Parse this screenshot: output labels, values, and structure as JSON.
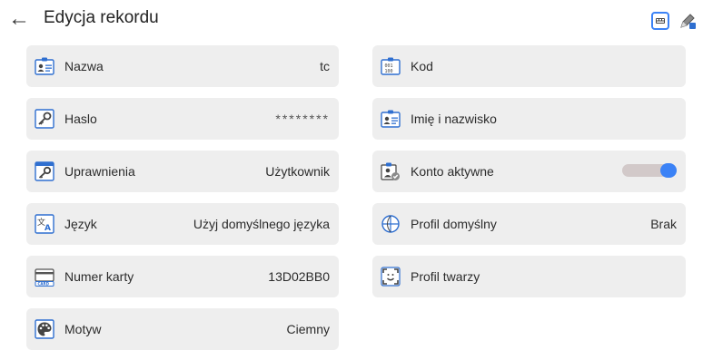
{
  "header": {
    "title": "Edycja rekordu",
    "back_icon": "arrow-left-icon",
    "right_icons": [
      "keyboard-icon",
      "edit-icon"
    ]
  },
  "fields_left": [
    {
      "label": "Nazwa",
      "value": "tc",
      "icon": "user-card-icon"
    },
    {
      "label": "Haslo",
      "value": "********",
      "icon": "key-icon"
    },
    {
      "label": "Uprawnienia",
      "value": "Użytkownik",
      "icon": "permissions-key-icon"
    },
    {
      "label": "Język",
      "value": "Użyj domyślnego języka",
      "icon": "translate-icon"
    },
    {
      "label": "Numer karty",
      "value": "13D02BB0",
      "icon": "card-icon"
    },
    {
      "label": "Motyw",
      "value": "Ciemny",
      "icon": "palette-icon"
    }
  ],
  "fields_right": [
    {
      "label": "Kod",
      "value": "",
      "icon": "code-card-icon"
    },
    {
      "label": "Imię i nazwisko",
      "value": "",
      "icon": "user-card-icon"
    },
    {
      "label": "Konto aktywne",
      "toggle_on": true,
      "icon": "user-check-icon"
    },
    {
      "label": "Profil domyślny",
      "value": "Brak",
      "icon": "globe-profile-icon"
    },
    {
      "label": "Profil twarzy",
      "value": "",
      "icon": "face-scan-icon"
    }
  ],
  "colors": {
    "field_bg": "#eeeeee",
    "accent": "#3b82f6",
    "toggle_track": "#d2c9c9"
  }
}
